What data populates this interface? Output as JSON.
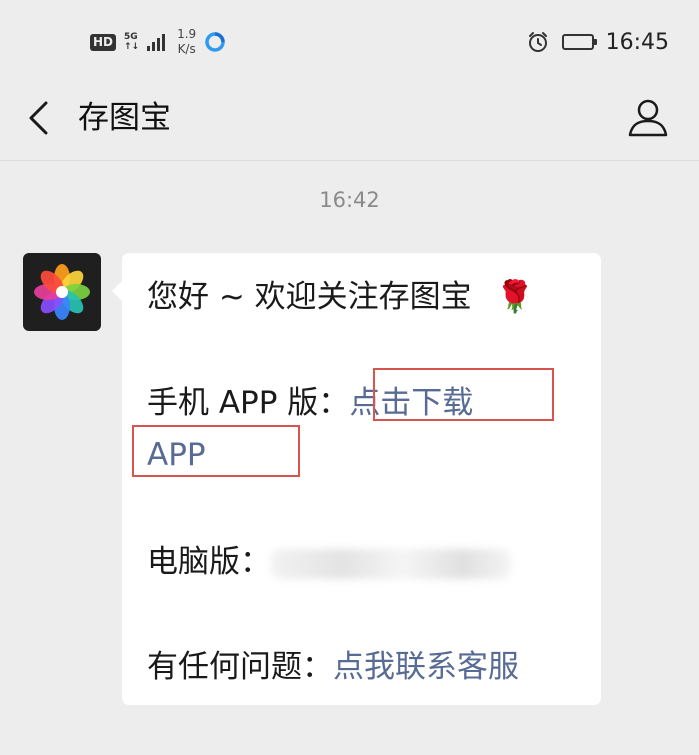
{
  "status_bar": {
    "hd": "HD",
    "network": "5G",
    "network_sub": "↑↓",
    "speed_value": "1.9",
    "speed_unit": "K/s",
    "time": "16:45",
    "icons": [
      "signal-icon",
      "location-icon",
      "alarm-icon",
      "battery-icon"
    ]
  },
  "nav": {
    "title": "存图宝",
    "back_icon": "chevron-left-icon",
    "profile_icon": "person-icon"
  },
  "chat": {
    "timestamp": "16:42",
    "message": {
      "greeting": "您好 ~ 欢迎关注存图宝",
      "emoji": "🌹",
      "app_label": "手机 APP 版：",
      "app_link_part1": "点击下载",
      "app_link_part2": "APP",
      "pc_label": "电脑版：",
      "help_label": "有任何问题：",
      "help_link": "点我联系客服"
    }
  },
  "colors": {
    "background": "#ededed",
    "bubble": "#ffffff",
    "link": "#576b95",
    "highlight_box": "#d9534f"
  }
}
